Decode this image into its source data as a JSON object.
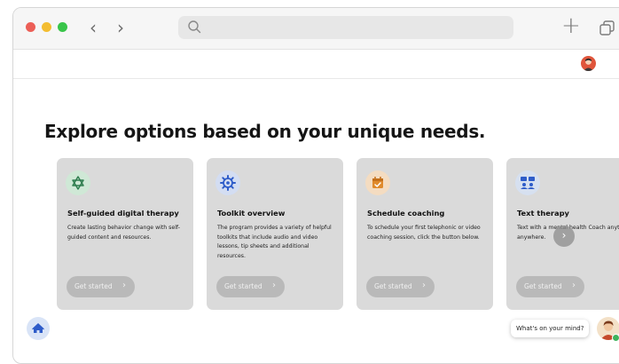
{
  "browser": {
    "traffic_lights": [
      "#ec5f57",
      "#f3bd31",
      "#39c54a"
    ],
    "back_icon": "chevron-left-icon",
    "forward_icon": "chevron-right-icon",
    "address_icon": "search-icon",
    "address_placeholder": "",
    "new_tab_icon": "plus-icon",
    "tabs_icon": "tabs-overview-icon"
  },
  "header": {
    "avatar_icon": "user-avatar"
  },
  "main": {
    "headline": "Explore options based on your unique needs.",
    "cards": [
      {
        "icon": "spinner-star-icon",
        "icon_bg": "#cfe8d6",
        "title": "Self-guided digital therapy",
        "description": "Create lasting behavior change with self-guided content and resources.",
        "button_label": "Get started"
      },
      {
        "icon": "gear-icon",
        "icon_bg": "#d3ddf2",
        "title": "Toolkit overview",
        "description": "The program provides a variety of helpful toolkits that include audio and video lessons, tip sheets and additional resources.",
        "button_label": "Get started"
      },
      {
        "icon": "calendar-check-icon",
        "icon_bg": "#f4dcc1",
        "title": "Schedule coaching",
        "description": "To schedule your first telephonic or video coaching session, click the button below.",
        "button_label": "Get started"
      },
      {
        "icon": "chat-people-icon",
        "icon_bg": "#d6e0f0",
        "title": "Text therapy",
        "description": "Text with a mental health Coach anytime, anywhere.",
        "button_label": "Get started"
      }
    ],
    "next_icon": "chevron-right-icon"
  },
  "footer": {
    "home_icon": "home-icon",
    "chat_prompt": "What's on your mind?",
    "chat_avatar": "assistant-avatar"
  }
}
